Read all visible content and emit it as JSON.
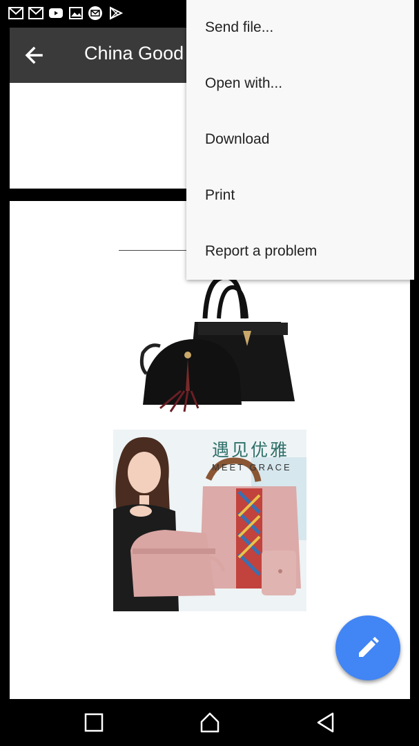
{
  "status_bar": {
    "icons": [
      "gmail-icon",
      "gmail-icon",
      "youtube-icon",
      "image-icon",
      "mail-icon",
      "play-store-icon"
    ],
    "right_text": ""
  },
  "app_bar": {
    "title": "China Good",
    "back_icon": "arrow-back-icon"
  },
  "document": {
    "promo_text_cn": "遇见优雅",
    "promo_text_en": "MEET GRACE"
  },
  "menu": {
    "items": [
      {
        "label": "Send file..."
      },
      {
        "label": "Open with..."
      },
      {
        "label": "Download"
      },
      {
        "label": "Print"
      },
      {
        "label": "Report a problem"
      }
    ]
  },
  "fab": {
    "icon": "pencil-icon",
    "color": "#4285f4"
  },
  "nav_bar": {
    "icons": [
      "recents-icon",
      "home-icon",
      "back-icon"
    ]
  }
}
